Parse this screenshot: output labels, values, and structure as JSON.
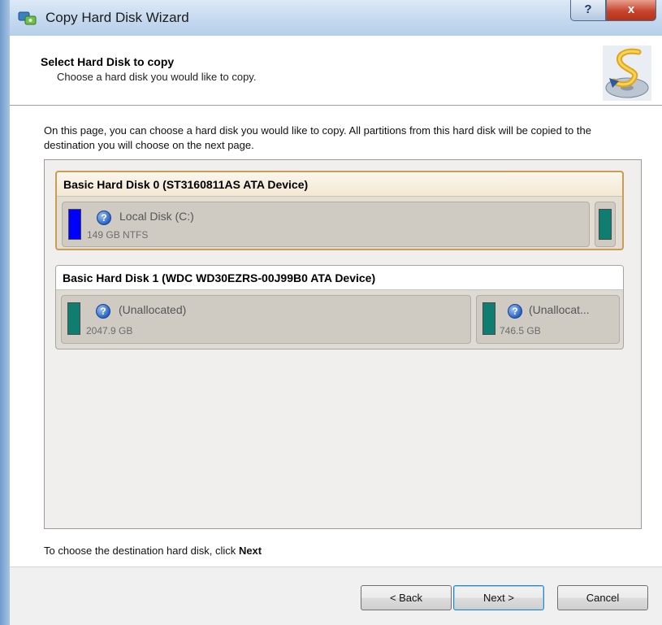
{
  "window": {
    "title": "Copy Hard Disk Wizard",
    "help_glyph": "?",
    "close_glyph": "x"
  },
  "header": {
    "title": "Select Hard Disk to copy",
    "subtitle": "Choose a hard disk you would like to copy."
  },
  "description": "On this page, you can choose a hard disk you would like to copy. All partitions from this hard disk will be copied to the destination you will choose on the next page.",
  "disks": [
    {
      "title": "Basic Hard Disk 0 (ST3160811AS ATA Device)",
      "selected": true,
      "partitions": [
        {
          "name": "Local Disk (C:)",
          "size": "149 GB NTFS",
          "bar_color": "#0000ff",
          "icon": "help-icon"
        }
      ],
      "trailing_bar_color": "#0f7e70"
    },
    {
      "title": "Basic Hard Disk 1 (WDC WD30EZRS-00J99B0 ATA Device)",
      "selected": false,
      "partitions": [
        {
          "name": "(Unallocated)",
          "size": "2047.9 GB",
          "bar_color": "#0f7e70",
          "icon": "help-icon"
        },
        {
          "name": "(Unallocat...",
          "size": "746.5 GB",
          "bar_color": "#0f7e70",
          "icon": "help-icon"
        }
      ]
    }
  ],
  "footer": {
    "hint_prefix": "To choose the destination hard disk, click",
    "hint_action": "Next"
  },
  "buttons": {
    "back": "< Back",
    "next": "Next >",
    "cancel": "Cancel"
  },
  "colors": {
    "selected_border": "#c99c58",
    "partition_blue": "#0000ff",
    "partition_teal": "#0f7e70"
  }
}
